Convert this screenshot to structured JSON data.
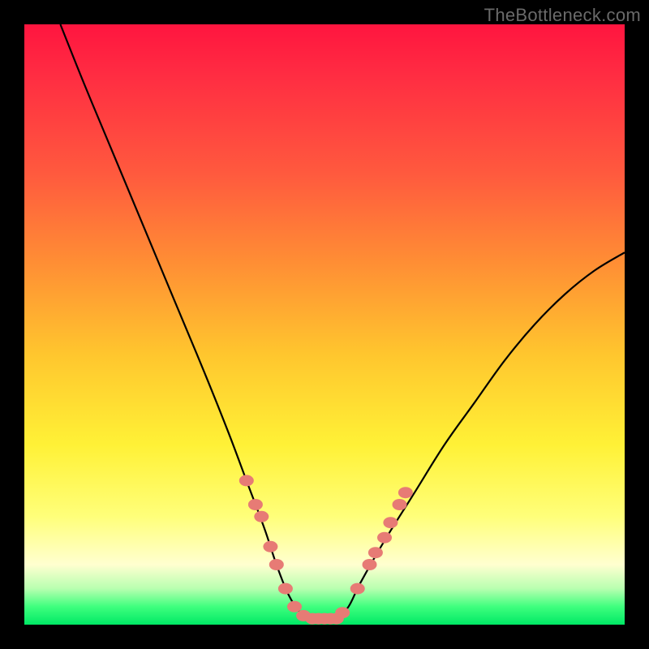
{
  "watermark": {
    "text": "TheBottleneck.com"
  },
  "colors": {
    "frame": "#000000",
    "curve_stroke": "#000000",
    "marker_fill": "#e77b75",
    "marker_stroke": "#c4554f"
  },
  "chart_data": {
    "type": "line",
    "title": "",
    "xlabel": "",
    "ylabel": "",
    "xlim": [
      0,
      100
    ],
    "ylim": [
      0,
      100
    ],
    "grid": false,
    "legend": false,
    "annotations": [],
    "series": [
      {
        "name": "bottleneck-curve",
        "x": [
          6,
          10,
          15,
          20,
          25,
          30,
          34,
          37,
          40,
          42,
          44,
          46,
          48,
          50,
          52,
          54,
          56,
          60,
          65,
          70,
          75,
          80,
          85,
          90,
          95,
          100
        ],
        "values": [
          100,
          90,
          78,
          66,
          54,
          42,
          32,
          24,
          16,
          10,
          5,
          2,
          1,
          1,
          1,
          3,
          7,
          14,
          22,
          30,
          37,
          44,
          50,
          55,
          59,
          62
        ]
      }
    ],
    "markers": {
      "name": "highlighted-points",
      "points": [
        {
          "x": 37.0,
          "y": 24.0
        },
        {
          "x": 38.5,
          "y": 20.0
        },
        {
          "x": 39.5,
          "y": 18.0
        },
        {
          "x": 41.0,
          "y": 13.0
        },
        {
          "x": 42.0,
          "y": 10.0
        },
        {
          "x": 43.5,
          "y": 6.0
        },
        {
          "x": 45.0,
          "y": 3.0
        },
        {
          "x": 46.5,
          "y": 1.5
        },
        {
          "x": 48.0,
          "y": 1.0
        },
        {
          "x": 49.0,
          "y": 1.0
        },
        {
          "x": 50.0,
          "y": 1.0
        },
        {
          "x": 51.0,
          "y": 1.0
        },
        {
          "x": 52.0,
          "y": 1.0
        },
        {
          "x": 53.0,
          "y": 2.0
        },
        {
          "x": 55.5,
          "y": 6.0
        },
        {
          "x": 57.5,
          "y": 10.0
        },
        {
          "x": 58.5,
          "y": 12.0
        },
        {
          "x": 60.0,
          "y": 14.5
        },
        {
          "x": 61.0,
          "y": 17.0
        },
        {
          "x": 62.5,
          "y": 20.0
        },
        {
          "x": 63.5,
          "y": 22.0
        }
      ]
    }
  }
}
